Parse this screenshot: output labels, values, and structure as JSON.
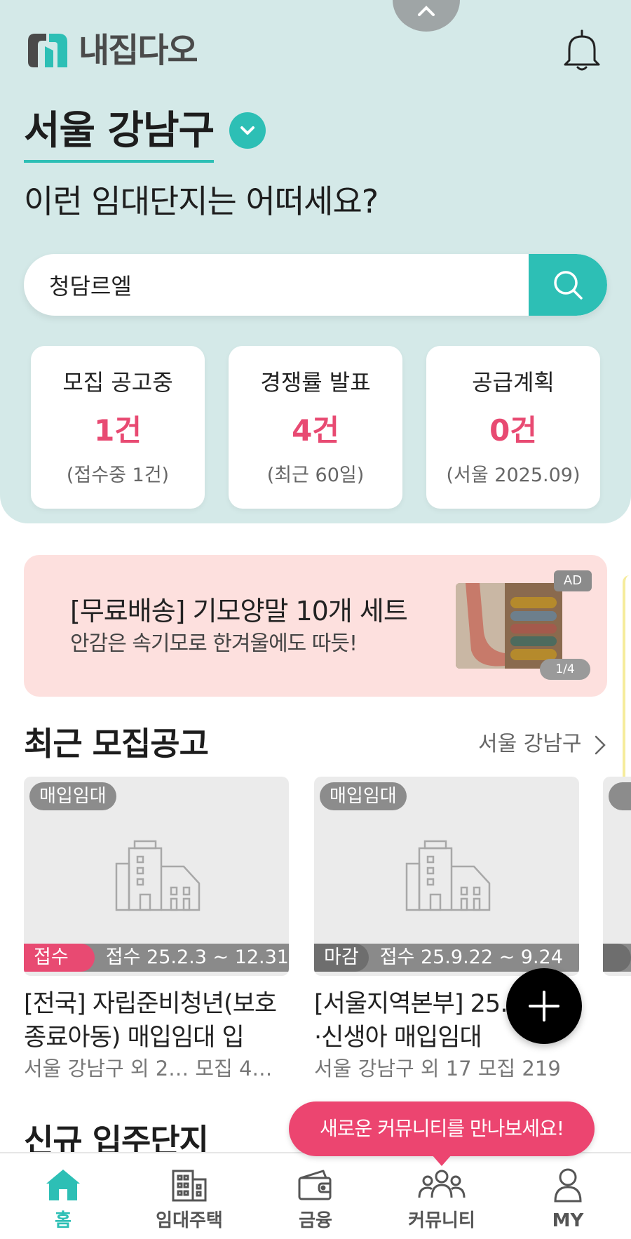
{
  "app": {
    "logo_text": "내집다오"
  },
  "header": {
    "region": "서울 강남구",
    "subtitle": "이런 임대단지는 어떠세요?"
  },
  "search": {
    "value": "청담르엘"
  },
  "stats": [
    {
      "title": "모집 공고중",
      "count": "1건",
      "note": "(접수중 1건)"
    },
    {
      "title": "경쟁률 발표",
      "count": "4건",
      "note": "(최근 60일)"
    },
    {
      "title": "공급계획",
      "count": "0건",
      "note": "(서울 2025.09)"
    }
  ],
  "ad": {
    "title": "[무료배송] 기모양말 10개 세트",
    "subtitle": "안감은 속기모로 한겨울에도 따듯!",
    "badge": "AD",
    "page": "1/4"
  },
  "recent": {
    "section_title": "최근 모집공고",
    "region_link": "서울 강남구",
    "cards": [
      {
        "tag": "매입임대",
        "status": "접수중",
        "period": "접수 25.2.3 ~ 12.31",
        "title": "[전국] 자립준비청년(보호종료아동) 매입임대 입",
        "meta": "서울 강남구 외 2…   모집 4…"
      },
      {
        "tag": "매입임대",
        "status": "마감",
        "period": "접수 25.9.22 ~ 9.24",
        "title": "[서울지역본부] 25… 신혼·신생아 매입임대",
        "meta": "서울 강남구 외 17   모집 219"
      }
    ]
  },
  "next_section": {
    "title": "신규 입주단지"
  },
  "community_prompt": "새로운 커뮤니티를 만나보세요!",
  "tabs": [
    {
      "label": "홈",
      "icon": "home-icon",
      "active": true
    },
    {
      "label": "임대주택",
      "icon": "building-icon",
      "active": false
    },
    {
      "label": "금융",
      "icon": "wallet-icon",
      "active": false
    },
    {
      "label": "커뮤니티",
      "icon": "community-icon",
      "active": false
    },
    {
      "label": "MY",
      "icon": "user-icon",
      "active": false
    }
  ],
  "colors": {
    "accent": "#2dbfb5",
    "highlight": "#e84a72",
    "hero_bg": "#d4e9e8",
    "ad_bg": "#fde0de"
  }
}
